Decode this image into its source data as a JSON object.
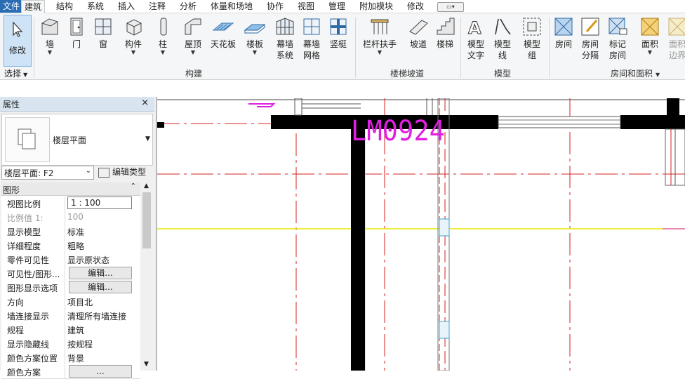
{
  "menu": {
    "tabs": [
      "文件",
      "建筑",
      "结构",
      "系统",
      "插入",
      "注释",
      "分析",
      "体量和场地",
      "协作",
      "视图",
      "管理",
      "附加模块",
      "修改"
    ],
    "active_tab": "建筑"
  },
  "ribbon": {
    "modify": {
      "label": "修改"
    },
    "select": {
      "label": "选择"
    },
    "build": {
      "group_label": "构建",
      "items": [
        "墙",
        "门",
        "窗",
        "构件",
        "柱",
        "屋顶",
        "天花板",
        "楼板",
        "幕墙系统",
        "幕墙网格",
        "竖梃"
      ]
    },
    "stairs": {
      "group_label": "楼梯坡道",
      "items": [
        "栏杆扶手",
        "坡道",
        "楼梯"
      ]
    },
    "model": {
      "group_label": "模型",
      "items": [
        "模型文字",
        "模型线",
        "模型组"
      ]
    },
    "room": {
      "group_label": "房间和面积",
      "items": [
        "房间",
        "房间分隔",
        "标记房间",
        "面积",
        "面积边界"
      ]
    }
  },
  "properties": {
    "title": "属性",
    "close": "×",
    "type_name": "楼层平面",
    "level_selector": "楼层平面: F2",
    "edit_type": "编辑类型",
    "section": "图形",
    "rows": [
      {
        "key": "视图比例",
        "value": "1 : 100",
        "kind": "input"
      },
      {
        "key": "比例值 1:",
        "value": "100",
        "kind": "disabled"
      },
      {
        "key": "显示模型",
        "value": "标准",
        "kind": "text"
      },
      {
        "key": "详细程度",
        "value": "粗略",
        "kind": "text"
      },
      {
        "key": "零件可见性",
        "value": "显示原状态",
        "kind": "text"
      },
      {
        "key": "可见性/图形...",
        "value": "编辑...",
        "kind": "button"
      },
      {
        "key": "图形显示选项",
        "value": "编辑...",
        "kind": "button"
      },
      {
        "key": "方向",
        "value": "项目北",
        "kind": "text"
      },
      {
        "key": "墙连接显示",
        "value": "清理所有墙连接",
        "kind": "text"
      },
      {
        "key": "规程",
        "value": "建筑",
        "kind": "text"
      },
      {
        "key": "显示隐藏线",
        "value": "按规程",
        "kind": "text"
      },
      {
        "key": "颜色方案位置",
        "value": "背景",
        "kind": "text"
      },
      {
        "key": "颜色方案",
        "value": "...",
        "kind": "button"
      }
    ]
  },
  "canvas": {
    "door_tag": "LM0924",
    "tag_color": "#e020e0",
    "grid_color": "#d42020",
    "level_line_color": "#e8e800"
  }
}
